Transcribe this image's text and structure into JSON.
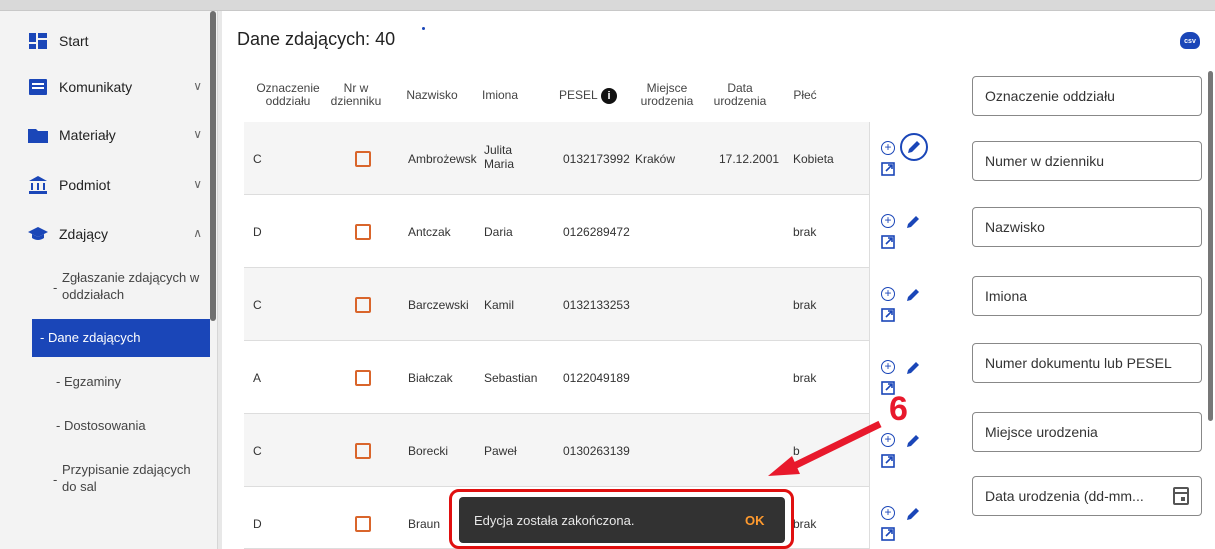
{
  "sidebar": {
    "items": [
      {
        "label": "Start",
        "icon": "dashboard-icon"
      },
      {
        "label": "Komunikaty",
        "icon": "message-icon"
      },
      {
        "label": "Materiały",
        "icon": "folder-icon"
      },
      {
        "label": "Podmiot",
        "icon": "institution-icon"
      },
      {
        "label": "Zdający",
        "icon": "graduation-cap-icon"
      }
    ],
    "subitems": [
      {
        "label": "Zgłaszanie zdających w oddziałach",
        "prefix": "-"
      },
      {
        "label": "- Dane zdających"
      },
      {
        "label": "- Egzaminy"
      },
      {
        "label": "- Dostosowania"
      },
      {
        "label": "Przypisanie zdających do sal",
        "prefix": "-"
      }
    ]
  },
  "main": {
    "title": "Dane zdających: 40",
    "csv_label": "csv",
    "columns": [
      "Oznaczenie oddziału",
      "Nr w dzienniku",
      "Nazwisko",
      "Imiona",
      "PESEL",
      "Miejsce urodzenia",
      "Data urodzenia",
      "Płeć"
    ],
    "rows": [
      {
        "oddzial": "C",
        "nazwisko": "Ambrożewsk",
        "imiona": "Julita Maria",
        "pesel": "0132173992",
        "miejsce": "Kraków",
        "data": "17.12.2001",
        "plec": "Kobieta"
      },
      {
        "oddzial": "D",
        "nazwisko": "Antczak",
        "imiona": "Daria",
        "pesel": "0126289472",
        "miejsce": "",
        "data": "",
        "plec": "brak"
      },
      {
        "oddzial": "C",
        "nazwisko": "Barczewski",
        "imiona": "Kamil",
        "pesel": "0132133253",
        "miejsce": "",
        "data": "",
        "plec": "brak"
      },
      {
        "oddzial": "A",
        "nazwisko": "Białczak",
        "imiona": "Sebastian",
        "pesel": "0122049189",
        "miejsce": "",
        "data": "",
        "plec": "brak"
      },
      {
        "oddzial": "C",
        "nazwisko": "Borecki",
        "imiona": "Paweł",
        "pesel": "0130263139",
        "miejsce": "",
        "data": "",
        "plec": "b"
      },
      {
        "oddzial": "D",
        "nazwisko": "Braun",
        "imiona": "",
        "pesel": "",
        "miejsce": "",
        "data": "",
        "plec": "brak"
      }
    ]
  },
  "filters": [
    "Oznaczenie oddziału",
    "Numer w dzienniku",
    "Nazwisko",
    "Imiona",
    "Numer dokumentu lub PESEL",
    "Miejsce urodzenia",
    "Data urodzenia (dd-mm..."
  ],
  "snackbar": {
    "message": "Edycja została zakończona.",
    "action": "OK"
  },
  "annotation": {
    "number": "6"
  },
  "colors": {
    "accent": "#1a46b8",
    "checkbox": "#d9652b",
    "annotation": "#e01010",
    "snack_action": "#ff9a2e"
  }
}
